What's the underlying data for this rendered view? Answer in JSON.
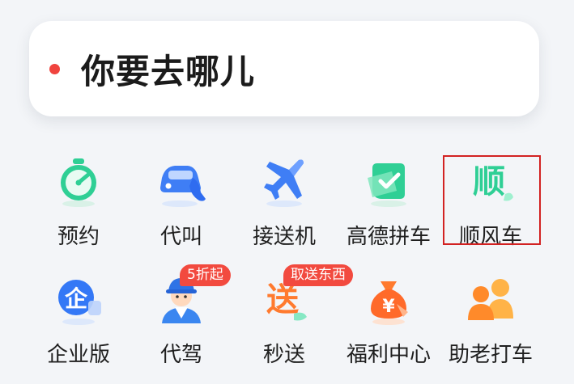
{
  "search": {
    "prompt": "你要去哪儿"
  },
  "colors": {
    "accent_red": "#f0443e",
    "badge_red": "#f24a3f",
    "highlight_border": "#d22222",
    "green": "#2fcf95",
    "blue": "#3478f6",
    "orange": "#ff7a2e"
  },
  "services": {
    "row1": [
      {
        "label": "预约",
        "icon": "stopwatch-icon"
      },
      {
        "label": "代叫",
        "icon": "car-phone-icon"
      },
      {
        "label": "接送机",
        "icon": "airplane-icon"
      },
      {
        "label": "高德拼车",
        "icon": "carpool-check-icon"
      },
      {
        "label": "顺风车",
        "icon": "shunfeng-logo-icon",
        "highlighted": true
      }
    ],
    "row2": [
      {
        "label": "企业版",
        "icon": "enterprise-icon"
      },
      {
        "label": "代驾",
        "icon": "driver-avatar-icon",
        "badge": "5折起"
      },
      {
        "label": "秒送",
        "icon": "miaosong-logo-icon",
        "badge": "取送东西"
      },
      {
        "label": "福利中心",
        "icon": "money-bag-icon"
      },
      {
        "label": "助老打车",
        "icon": "elderly-people-icon"
      }
    ]
  }
}
